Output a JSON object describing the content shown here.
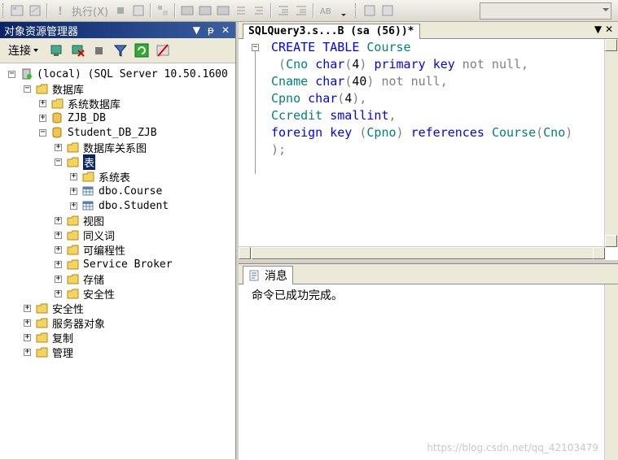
{
  "toolbar": {
    "execute_label": "执行(X)"
  },
  "object_explorer": {
    "title": "对象资源管理器",
    "title_controls": "▾ ᵽ ✕",
    "connect_label": "连接",
    "tree": [
      {
        "label": "(local) (SQL Server 10.50.1600",
        "depth": 0,
        "exp": "-",
        "icon": "server-icon"
      },
      {
        "label": "数据库",
        "depth": 1,
        "exp": "-",
        "icon": "folder-icon"
      },
      {
        "label": "系统数据库",
        "depth": 2,
        "exp": "+",
        "icon": "folder-icon"
      },
      {
        "label": "ZJB_DB",
        "depth": 2,
        "exp": "+",
        "icon": "database-icon"
      },
      {
        "label": "Student_DB_ZJB",
        "depth": 2,
        "exp": "-",
        "icon": "database-icon"
      },
      {
        "label": "数据库关系图",
        "depth": 3,
        "exp": "+",
        "icon": "folder-icon"
      },
      {
        "label": "表",
        "depth": 3,
        "exp": "-",
        "icon": "folder-icon",
        "selected": true
      },
      {
        "label": "系统表",
        "depth": 4,
        "exp": "+",
        "icon": "folder-icon"
      },
      {
        "label": "dbo.Course",
        "depth": 4,
        "exp": "+",
        "icon": "table-icon"
      },
      {
        "label": "dbo.Student",
        "depth": 4,
        "exp": "+",
        "icon": "table-icon"
      },
      {
        "label": "视图",
        "depth": 3,
        "exp": "+",
        "icon": "folder-icon"
      },
      {
        "label": "同义词",
        "depth": 3,
        "exp": "+",
        "icon": "folder-icon"
      },
      {
        "label": "可编程性",
        "depth": 3,
        "exp": "+",
        "icon": "folder-icon"
      },
      {
        "label": "Service Broker",
        "depth": 3,
        "exp": "+",
        "icon": "folder-icon"
      },
      {
        "label": "存储",
        "depth": 3,
        "exp": "+",
        "icon": "folder-icon"
      },
      {
        "label": "安全性",
        "depth": 3,
        "exp": "+",
        "icon": "folder-icon"
      },
      {
        "label": "安全性",
        "depth": 1,
        "exp": "+",
        "icon": "folder-icon"
      },
      {
        "label": "服务器对象",
        "depth": 1,
        "exp": "+",
        "icon": "folder-icon"
      },
      {
        "label": "复制",
        "depth": 1,
        "exp": "+",
        "icon": "folder-icon"
      },
      {
        "label": "管理",
        "depth": 1,
        "exp": "+",
        "icon": "folder-icon"
      }
    ]
  },
  "editor": {
    "tab_title": "SQLQuery3.s...B (sa (56))*",
    "tab_controls": "▾ ✕",
    "lines": [
      [
        {
          "t": "CREATE",
          "c": "kw"
        },
        {
          "t": " ",
          "c": ""
        },
        {
          "t": "TABLE",
          "c": "kw"
        },
        {
          "t": " ",
          "c": ""
        },
        {
          "t": "Course",
          "c": "ty"
        }
      ],
      [
        {
          "t": " (",
          "c": "gr"
        },
        {
          "t": "Cno",
          "c": "ty"
        },
        {
          "t": " ",
          "c": ""
        },
        {
          "t": "char",
          "c": "kw"
        },
        {
          "t": "(",
          "c": "gr"
        },
        {
          "t": "4",
          "c": ""
        },
        {
          "t": ")",
          "c": "gr"
        },
        {
          "t": " ",
          "c": ""
        },
        {
          "t": "primary",
          "c": "kw"
        },
        {
          "t": " ",
          "c": ""
        },
        {
          "t": "key",
          "c": "kw"
        },
        {
          "t": " not null,",
          "c": "gr"
        }
      ],
      [
        {
          "t": "Cname",
          "c": "ty"
        },
        {
          "t": " ",
          "c": ""
        },
        {
          "t": "char",
          "c": "kw"
        },
        {
          "t": "(",
          "c": "gr"
        },
        {
          "t": "40",
          "c": ""
        },
        {
          "t": ")",
          "c": "gr"
        },
        {
          "t": " not null,",
          "c": "gr"
        }
      ],
      [
        {
          "t": "Cpno",
          "c": "ty"
        },
        {
          "t": " ",
          "c": ""
        },
        {
          "t": "char",
          "c": "kw"
        },
        {
          "t": "(",
          "c": "gr"
        },
        {
          "t": "4",
          "c": ""
        },
        {
          "t": "),",
          "c": "gr"
        }
      ],
      [
        {
          "t": "Ccredit",
          "c": "ty"
        },
        {
          "t": " ",
          "c": ""
        },
        {
          "t": "smallint",
          "c": "kw"
        },
        {
          "t": ",",
          "c": "gr"
        }
      ],
      [
        {
          "t": "foreign",
          "c": "kw"
        },
        {
          "t": " ",
          "c": ""
        },
        {
          "t": "key",
          "c": "kw"
        },
        {
          "t": " (",
          "c": "gr"
        },
        {
          "t": "Cpno",
          "c": "ty"
        },
        {
          "t": ")",
          "c": "gr"
        },
        {
          "t": " ",
          "c": ""
        },
        {
          "t": "references",
          "c": "kw"
        },
        {
          "t": " ",
          "c": ""
        },
        {
          "t": "Course",
          "c": "ty"
        },
        {
          "t": "(",
          "c": "gr"
        },
        {
          "t": "Cno",
          "c": "ty"
        },
        {
          "t": ")",
          "c": "gr"
        }
      ],
      [
        {
          "t": ");",
          "c": "gr"
        }
      ]
    ]
  },
  "messages": {
    "tab_label": "消息",
    "text": "命令已成功完成。"
  },
  "watermark": "https://blog.csdn.net/qq_42103479"
}
